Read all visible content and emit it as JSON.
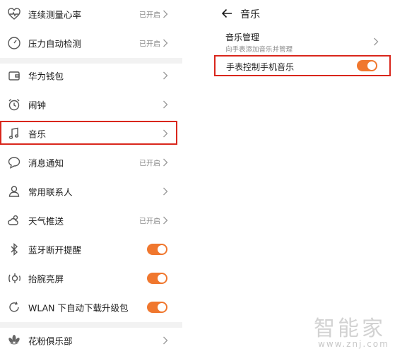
{
  "left_list": {
    "items": [
      {
        "label": "连续测量心率",
        "status": "已开启",
        "icon": "heart-rate-icon"
      },
      {
        "label": "压力自动检测",
        "status": "已开启",
        "icon": "gauge-icon"
      },
      {
        "label": "华为钱包",
        "status": "",
        "icon": "wallet-icon"
      },
      {
        "label": "闹钟",
        "status": "",
        "icon": "alarm-clock-icon"
      },
      {
        "label": "音乐",
        "status": "",
        "icon": "music-note-icon"
      },
      {
        "label": "消息通知",
        "status": "已开启",
        "icon": "chat-bubble-icon"
      },
      {
        "label": "常用联系人",
        "status": "",
        "icon": "person-icon"
      },
      {
        "label": "天气推送",
        "status": "已开启",
        "icon": "weather-icon"
      },
      {
        "label": "蓝牙断开提醒",
        "toggle": true,
        "icon": "bluetooth-icon"
      },
      {
        "label": "抬腕亮屏",
        "toggle": true,
        "icon": "raise-wrist-icon"
      },
      {
        "label": "WLAN 下自动下载升级包",
        "toggle": true,
        "icon": "refresh-icon"
      },
      {
        "label": "花粉俱乐部",
        "status": "",
        "icon": "flower-icon"
      }
    ]
  },
  "music_page": {
    "title": "音乐",
    "music_management": {
      "title": "音乐管理",
      "subtitle": "向手表添加音乐并管理"
    },
    "watch_control": {
      "label": "手表控制手机音乐",
      "enabled": true
    }
  },
  "watermark": {
    "cn": "智能家",
    "url": "www.znj.com"
  },
  "colors": {
    "accent": "#f0772e",
    "highlight": "#d9261c",
    "divider": "#f2f2f2"
  }
}
